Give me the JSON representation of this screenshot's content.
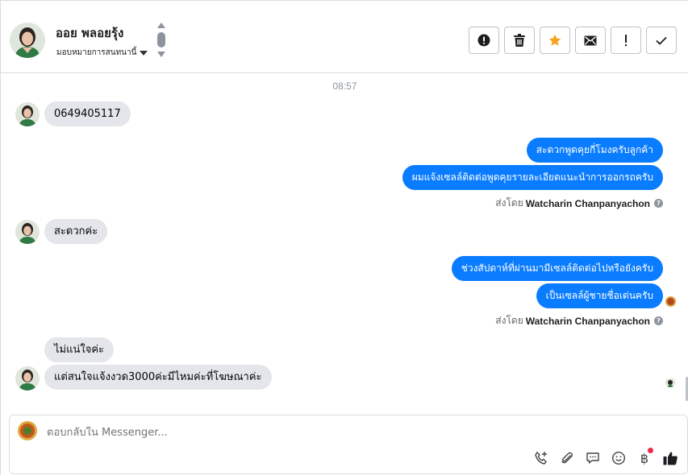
{
  "header": {
    "contact_name": "ออย พลอยรุ้ง",
    "assign_label": "มอบหมายการสนทนานี้",
    "toolbar": [
      {
        "name": "mark-spam-button",
        "icon": "exclamation-circle-icon"
      },
      {
        "name": "delete-button",
        "icon": "trash-icon"
      },
      {
        "name": "star-button",
        "icon": "star-icon"
      },
      {
        "name": "mark-unread-button",
        "icon": "envelope-icon"
      },
      {
        "name": "follow-up-button",
        "icon": "exclamation-icon"
      },
      {
        "name": "mark-done-button",
        "icon": "check-icon"
      }
    ]
  },
  "thread": {
    "timestamp": "08:57",
    "messages": [
      {
        "from": "contact",
        "text": "0649405117"
      },
      {
        "from": "page",
        "text": "สะดวกพูดคุยกี่โมงครับลูกค้า"
      },
      {
        "from": "page",
        "text": "ผมแจ้งเซลล์ติดต่อพูดคุยรายละเอียดแนะนำการออกรถครับ"
      },
      {
        "from": "contact",
        "text": "สะดวกค่ะ"
      },
      {
        "from": "page",
        "text": "ช่วงสัปดาห์ที่ผ่านมามีเซลล์ติดต่อไปหรือยังครับ"
      },
      {
        "from": "page",
        "text": "เป็นเซลล์ผู้ชายชื่อเด่นครับ"
      },
      {
        "from": "contact",
        "text": "ไม่แน่ใจค่ะ"
      },
      {
        "from": "contact",
        "text": "แต่สนใจแจ้งงวด3000ค่ะมีไหมค่ะที่โฆษณาค่ะ"
      }
    ],
    "sent_by_prefix": "ส่งโดย",
    "sent_by_name": "Watcharin Chanpanyachon"
  },
  "composer": {
    "placeholder": "ตอบกลับใน Messenger...",
    "icons": [
      "phone-add-icon",
      "paperclip-icon",
      "saved-reply-icon",
      "emoji-icon",
      "baht-payment-icon",
      "thumbs-up-icon"
    ],
    "baht_symbol": "฿"
  },
  "colors": {
    "outgoing_bubble": "#0a7cff",
    "incoming_bubble": "#e4e6eb",
    "star": "#f7a21b",
    "notification_dot": "#f02849"
  }
}
